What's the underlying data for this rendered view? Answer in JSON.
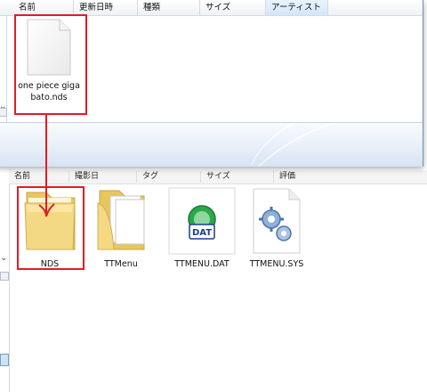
{
  "top_window": {
    "columns": [
      "名前",
      "更新日時",
      "種類",
      "サイズ",
      "アーティスト"
    ],
    "file": {
      "name": "one piece giga bato.nds",
      "icon": "blank-document-icon"
    }
  },
  "bottom_window": {
    "columns": [
      "名前",
      "撮影日",
      "タグ",
      "サイズ",
      "評価"
    ],
    "files": [
      {
        "name": "NDS",
        "icon": "folder-icon"
      },
      {
        "name": "TTMenu",
        "icon": "folder-with-documents-icon"
      },
      {
        "name": "TTMENU.DAT",
        "icon": "dat-file-icon",
        "badge": "DAT"
      },
      {
        "name": "TTMENU.SYS",
        "icon": "system-file-gears-icon"
      }
    ]
  },
  "colors": {
    "annotation_red": "#e31b23",
    "folder_yellow": "#f2d57a",
    "dat_green": "#2ba84a",
    "status_blue": "#d6e4f3"
  }
}
